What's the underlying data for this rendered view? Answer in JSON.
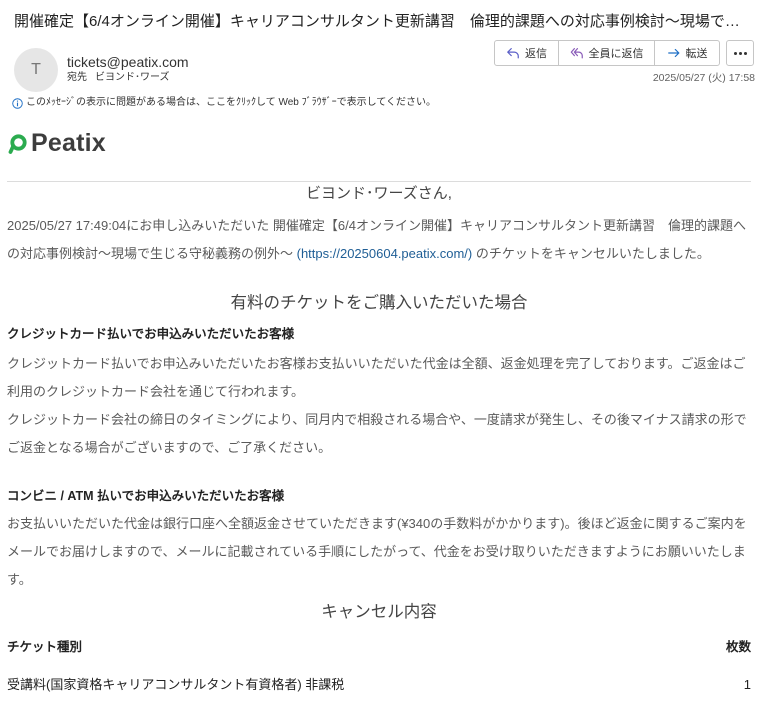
{
  "email": {
    "subject": "開催確定【6/4オンライン開催】キャリアコンサルタント更新講習　倫理的課題への対応事例検討～現場で…",
    "sender": {
      "avatar_initial": "T",
      "address": "tickets@peatix.com"
    },
    "to": {
      "label": "宛先",
      "name": "ビヨンド･ワーズ"
    },
    "date": "2025/05/27 (火) 17:58",
    "actions": {
      "reply": "返信",
      "reply_all": "全員に返信",
      "forward": "転送"
    },
    "info_bar": "このﾒｯｾｰｼﾞの表示に問題がある場合は、ここをｸﾘｯｸして Web ﾌﾞﾗｳｻﾞｰで表示してください。"
  },
  "body": {
    "logo_text": "Peatix",
    "greeting": "ビヨンド･ワーズさん,",
    "intro": {
      "before_link": "2025/05/27 17:49:04にお申し込みいただいた 開催確定【6/4オンライン開催】キャリアコンサルタント更新講習　倫理的課題への対応事例検討～現場で生じる守秘義務の例外～ ",
      "link": "(https://20250604.peatix.com/)",
      "after_link": " のチケットをキャンセルいたしました。"
    },
    "paid": {
      "heading": "有料のチケットをご購入いただいた場合",
      "credit": {
        "title": "クレジットカード払いでお申込みいただいたお客様",
        "paragraphs": [
          "クレジットカード払いでお申込みいただいたお客様お支払いいただいた代金は全額、返金処理を完了しております。ご返金はご利用のクレジットカード会社を通じて行われます。",
          "クレジットカード会社の締日のタイミングにより、同月内で相殺される場合や、一度請求が発生し、その後マイナス請求の形でご返金となる場合がございますので、ご了承ください。"
        ]
      },
      "convenience": {
        "title": "コンビニ / ATM 払いでお申込みいただいたお客様",
        "paragraphs": [
          "お支払いいただいた代金は銀行口座へ全額返金させていただきます(¥340の手数料がかかります)。後ほど返金に関するご案内をメールでお届けしますので、メールに記載されている手順にしたがって、代金をお受け取りいただきますようにお願いいたします。"
        ]
      }
    },
    "cancel": {
      "heading": "キャンセル内容",
      "columns": [
        "チケット種別",
        "枚数"
      ],
      "rows": [
        {
          "type": "受講料(国家資格キャリアコンサルタント有資格者) 非課税",
          "count": "1"
        }
      ]
    }
  },
  "icons": {
    "reply": "reply-icon",
    "reply_all": "reply-all-icon",
    "forward": "forward-icon",
    "more": "more-horizontal-icon",
    "info": "info-icon",
    "logo": "peatix-logo-icon"
  },
  "colors": {
    "peatix_green": "#2bab4f",
    "accent_blue": "#1f6fc5",
    "link": "#1f5e95",
    "body_text": "#5a5a5a"
  }
}
